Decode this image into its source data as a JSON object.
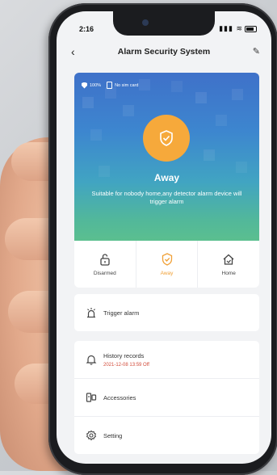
{
  "status_bar": {
    "time": "2:16",
    "icons": "▮▮▮ ≋"
  },
  "nav": {
    "back": "‹",
    "title": "Alarm Security System",
    "edit": "✎"
  },
  "hero": {
    "battery_text": "100%",
    "sim_text": "No sim card",
    "mode_name": "Away",
    "mode_desc": "Suitable for nobody home,any detector alarm device will trigger alarm"
  },
  "modes": [
    {
      "label": "Disarmed",
      "icon": "lock-open-icon"
    },
    {
      "label": "Away",
      "icon": "shield-icon",
      "active": true
    },
    {
      "label": "Home",
      "icon": "home-icon"
    }
  ],
  "trigger": {
    "label": "Trigger alarm"
  },
  "menu": {
    "history_label": "History records",
    "history_time": "2021-12-08 13:59 Off",
    "accessories_label": "Accessories",
    "setting_label": "Setting"
  },
  "colors": {
    "accent": "#f6a93b",
    "alert_text": "#d24b3a"
  }
}
